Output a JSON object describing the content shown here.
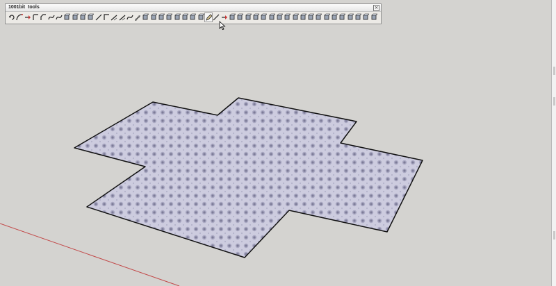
{
  "toolbar": {
    "title": "1001bit  tools",
    "close_symbol": "×",
    "buttons": [
      {
        "name": "rotate-tool",
        "glyph": "rotate"
      },
      {
        "name": "arc-tool",
        "glyph": "arc"
      },
      {
        "name": "arrow-tool",
        "glyph": "arrow"
      },
      {
        "name": "fillet-tool",
        "glyph": "fillet"
      },
      {
        "name": "chamfer-tool",
        "glyph": "chamfer"
      },
      {
        "name": "extend-tool",
        "glyph": "curve"
      },
      {
        "name": "offset-tool",
        "glyph": "curve"
      },
      {
        "name": "divide-tool",
        "glyph": "shape"
      },
      {
        "name": "perpendicular-tool",
        "glyph": "shape"
      },
      {
        "name": "align-tool",
        "glyph": "shape"
      },
      {
        "name": "array-tool",
        "glyph": "shape"
      },
      {
        "name": "line-tool",
        "glyph": "line"
      },
      {
        "name": "corner-tool",
        "glyph": "corner"
      },
      {
        "name": "slope-tool",
        "glyph": "slope"
      },
      {
        "name": "ramp-tool",
        "glyph": "slope"
      },
      {
        "name": "curve-tool",
        "glyph": "curve"
      },
      {
        "name": "stairs-tool",
        "glyph": "stairs"
      },
      {
        "name": "wall-tool",
        "glyph": "shape"
      },
      {
        "name": "column-tool",
        "glyph": "shape"
      },
      {
        "name": "beam-tool",
        "glyph": "shape"
      },
      {
        "name": "roof-tool",
        "glyph": "shape"
      },
      {
        "name": "window-tool",
        "glyph": "shape"
      },
      {
        "name": "door-tool",
        "glyph": "shape"
      },
      {
        "name": "pipe-tool",
        "glyph": "shape"
      },
      {
        "name": "extrude-tool",
        "glyph": "shape"
      },
      {
        "name": "pencil-tool",
        "glyph": "pencil"
      },
      {
        "name": "rafter-tool",
        "glyph": "line"
      },
      {
        "name": "truss-tool",
        "glyph": "arrow"
      },
      {
        "name": "joist-tool",
        "glyph": "shape"
      },
      {
        "name": "frame-tool",
        "glyph": "shape"
      },
      {
        "name": "grid-tool",
        "glyph": "shape"
      },
      {
        "name": "panel-tool",
        "glyph": "shape"
      },
      {
        "name": "louver-tool",
        "glyph": "shape"
      },
      {
        "name": "blind-tool",
        "glyph": "shape"
      },
      {
        "name": "shutter-tool",
        "glyph": "shape"
      },
      {
        "name": "fence-tool",
        "glyph": "shape"
      },
      {
        "name": "rail-tool",
        "glyph": "shape"
      },
      {
        "name": "post-tool",
        "glyph": "shape"
      },
      {
        "name": "canopy-tool",
        "glyph": "shape"
      },
      {
        "name": "deck-tool",
        "glyph": "shape"
      },
      {
        "name": "tile-tool",
        "glyph": "shape"
      },
      {
        "name": "floor-tool",
        "glyph": "shape"
      },
      {
        "name": "ceiling-tool",
        "glyph": "shape"
      },
      {
        "name": "glass-tool",
        "glyph": "shape"
      },
      {
        "name": "wheel-tool",
        "glyph": "shape"
      },
      {
        "name": "gear-tool",
        "glyph": "shape"
      },
      {
        "name": "sun-tool",
        "glyph": "shape"
      }
    ],
    "active_button_index": 25
  },
  "colors": {
    "background": "#d4d3d0",
    "face_fill": "#c9c8dc",
    "face_dot": "#6f6e86",
    "edge": "#111111",
    "red_axis": "#c24848"
  }
}
